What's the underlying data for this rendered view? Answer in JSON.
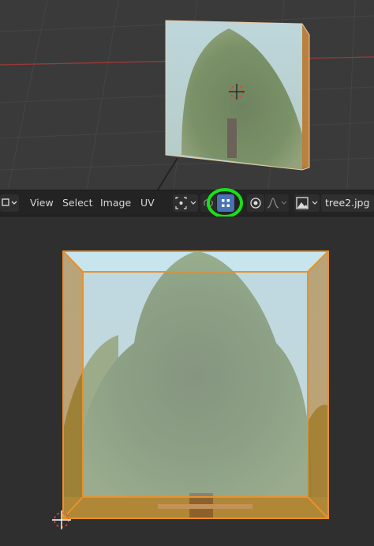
{
  "header": {
    "menu_view": "View",
    "menu_select": "Select",
    "menu_image": "Image",
    "menu_uv": "UV",
    "image_name": "tree2.jpg"
  },
  "icons": {
    "editor_type": "uv-editor-icon",
    "pivot": "pivot-point-icon",
    "sync": "uv-sync-selection-icon",
    "select_mode": "uv-vertex-select-mode-icon",
    "proportional": "proportional-editing-icon",
    "falloff": "falloff-curve-icon",
    "image_browse": "image-browse-icon"
  },
  "colors": {
    "highlight": "#19e019",
    "selection": "#e8912a",
    "active_button": "#4772b3",
    "axis_red": "#9a3a3a"
  }
}
